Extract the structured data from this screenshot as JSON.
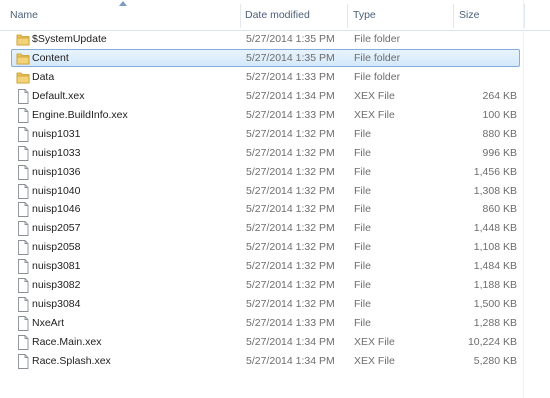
{
  "columns": {
    "name": "Name",
    "date": "Date modified",
    "type": "Type",
    "size": "Size"
  },
  "colors": {
    "selection_bg": "#d4e9fb",
    "selection_border": "#84acdd",
    "folder": "#e8c35b",
    "header_text": "#4c607a"
  },
  "files": [
    {
      "name": "$SystemUpdate",
      "date": "5/27/2014 1:35 PM",
      "type": "File folder",
      "size": "",
      "icon": "folder-icon",
      "selected": false
    },
    {
      "name": "Content",
      "date": "5/27/2014 1:35 PM",
      "type": "File folder",
      "size": "",
      "icon": "folder-icon",
      "selected": true
    },
    {
      "name": "Data",
      "date": "5/27/2014 1:33 PM",
      "type": "File folder",
      "size": "",
      "icon": "folder-icon",
      "selected": false
    },
    {
      "name": "Default.xex",
      "date": "5/27/2014 1:34 PM",
      "type": "XEX File",
      "size": "264 KB",
      "icon": "file-icon",
      "selected": false
    },
    {
      "name": "Engine.BuildInfo.xex",
      "date": "5/27/2014 1:33 PM",
      "type": "XEX File",
      "size": "100 KB",
      "icon": "file-icon",
      "selected": false
    },
    {
      "name": "nuisp1031",
      "date": "5/27/2014 1:32 PM",
      "type": "File",
      "size": "880 KB",
      "icon": "file-icon",
      "selected": false
    },
    {
      "name": "nuisp1033",
      "date": "5/27/2014 1:32 PM",
      "type": "File",
      "size": "996 KB",
      "icon": "file-icon",
      "selected": false
    },
    {
      "name": "nuisp1036",
      "date": "5/27/2014 1:32 PM",
      "type": "File",
      "size": "1,456 KB",
      "icon": "file-icon",
      "selected": false
    },
    {
      "name": "nuisp1040",
      "date": "5/27/2014 1:32 PM",
      "type": "File",
      "size": "1,308 KB",
      "icon": "file-icon",
      "selected": false
    },
    {
      "name": "nuisp1046",
      "date": "5/27/2014 1:32 PM",
      "type": "File",
      "size": "860 KB",
      "icon": "file-icon",
      "selected": false
    },
    {
      "name": "nuisp2057",
      "date": "5/27/2014 1:32 PM",
      "type": "File",
      "size": "1,448 KB",
      "icon": "file-icon",
      "selected": false
    },
    {
      "name": "nuisp2058",
      "date": "5/27/2014 1:32 PM",
      "type": "File",
      "size": "1,108 KB",
      "icon": "file-icon",
      "selected": false
    },
    {
      "name": "nuisp3081",
      "date": "5/27/2014 1:32 PM",
      "type": "File",
      "size": "1,484 KB",
      "icon": "file-icon",
      "selected": false
    },
    {
      "name": "nuisp3082",
      "date": "5/27/2014 1:32 PM",
      "type": "File",
      "size": "1,188 KB",
      "icon": "file-icon",
      "selected": false
    },
    {
      "name": "nuisp3084",
      "date": "5/27/2014 1:32 PM",
      "type": "File",
      "size": "1,500 KB",
      "icon": "file-icon",
      "selected": false
    },
    {
      "name": "NxeArt",
      "date": "5/27/2014 1:33 PM",
      "type": "File",
      "size": "1,288 KB",
      "icon": "file-icon",
      "selected": false
    },
    {
      "name": "Race.Main.xex",
      "date": "5/27/2014 1:34 PM",
      "type": "XEX File",
      "size": "10,224 KB",
      "icon": "file-icon",
      "selected": false
    },
    {
      "name": "Race.Splash.xex",
      "date": "5/27/2014 1:34 PM",
      "type": "XEX File",
      "size": "5,280 KB",
      "icon": "file-icon",
      "selected": false
    }
  ]
}
